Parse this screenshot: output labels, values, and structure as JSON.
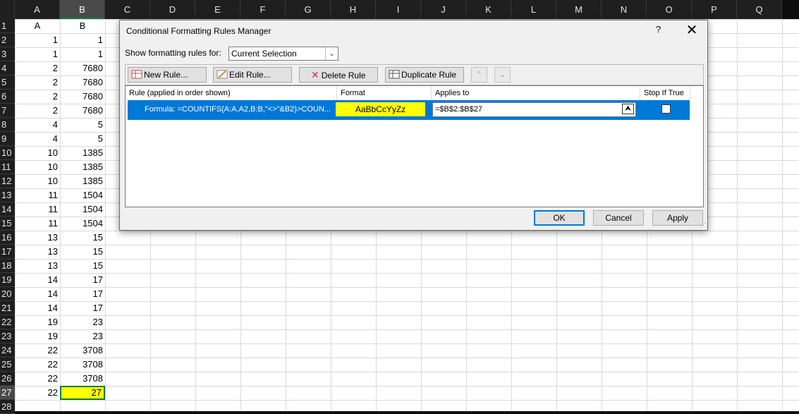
{
  "sheet": {
    "columns": [
      "A",
      "B",
      "C",
      "D",
      "E",
      "F",
      "G",
      "H",
      "I",
      "J",
      "K",
      "L",
      "M",
      "N",
      "O",
      "P",
      "Q"
    ],
    "selected_column": "B",
    "rows": [
      {
        "n": "1",
        "a": "A",
        "b": "B"
      },
      {
        "n": "2",
        "a": "1",
        "b": "1"
      },
      {
        "n": "3",
        "a": "1",
        "b": "1"
      },
      {
        "n": "4",
        "a": "2",
        "b": "7680"
      },
      {
        "n": "5",
        "a": "2",
        "b": "7680"
      },
      {
        "n": "6",
        "a": "2",
        "b": "7680"
      },
      {
        "n": "7",
        "a": "2",
        "b": "7680"
      },
      {
        "n": "8",
        "a": "4",
        "b": "5"
      },
      {
        "n": "9",
        "a": "4",
        "b": "5"
      },
      {
        "n": "10",
        "a": "10",
        "b": "1385"
      },
      {
        "n": "11",
        "a": "10",
        "b": "1385"
      },
      {
        "n": "12",
        "a": "10",
        "b": "1385"
      },
      {
        "n": "13",
        "a": "11",
        "b": "1504"
      },
      {
        "n": "14",
        "a": "11",
        "b": "1504"
      },
      {
        "n": "15",
        "a": "11",
        "b": "1504"
      },
      {
        "n": "16",
        "a": "13",
        "b": "15"
      },
      {
        "n": "17",
        "a": "13",
        "b": "15"
      },
      {
        "n": "18",
        "a": "13",
        "b": "15"
      },
      {
        "n": "19",
        "a": "14",
        "b": "17"
      },
      {
        "n": "20",
        "a": "14",
        "b": "17"
      },
      {
        "n": "21",
        "a": "14",
        "b": "17"
      },
      {
        "n": "22",
        "a": "19",
        "b": "23"
      },
      {
        "n": "23",
        "a": "19",
        "b": "23"
      },
      {
        "n": "24",
        "a": "22",
        "b": "3708"
      },
      {
        "n": "25",
        "a": "22",
        "b": "3708"
      },
      {
        "n": "26",
        "a": "22",
        "b": "3708"
      },
      {
        "n": "27",
        "a": "22",
        "b": "27"
      },
      {
        "n": "28",
        "a": "",
        "b": ""
      }
    ],
    "highlight_color": "#ffff00",
    "selection_color": "#107c41"
  },
  "dialog": {
    "title": "Conditional Formatting Rules Manager",
    "help": "?",
    "close": "✕",
    "show_rules_label": "Show formatting rules for:",
    "show_rules_value": "Current Selection",
    "buttons": {
      "new_rule": "New Rule...",
      "edit_rule": "Edit Rule...",
      "delete_rule": "Delete Rule",
      "duplicate_rule": "Duplicate Rule",
      "move_up": "⌃",
      "move_down": "⌄"
    },
    "columns": {
      "rule": "Rule (applied in order shown)",
      "format": "Format",
      "applies_to": "Applies to",
      "stop_if_true": "Stop If True"
    },
    "rule": {
      "name": "Formula: =COUNTIFS(A:A,A2,B:B,\"<>\"&B2)>COUN...",
      "format_preview": "AaBbCcYyZz",
      "applies_to": "=$B$2:$B$27",
      "stop_if_true": false
    },
    "footer": {
      "ok": "OK",
      "cancel": "Cancel",
      "apply": "Apply"
    },
    "accent_color": "#0078d7",
    "format_color": "#ffff00"
  }
}
